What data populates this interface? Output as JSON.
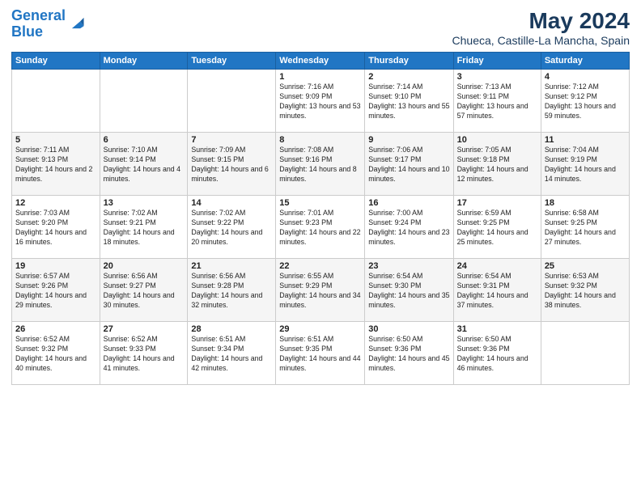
{
  "logo": {
    "line1": "General",
    "line2": "Blue"
  },
  "title": "May 2024",
  "location": "Chueca, Castille-La Mancha, Spain",
  "headers": [
    "Sunday",
    "Monday",
    "Tuesday",
    "Wednesday",
    "Thursday",
    "Friday",
    "Saturday"
  ],
  "weeks": [
    [
      {
        "day": "",
        "info": ""
      },
      {
        "day": "",
        "info": ""
      },
      {
        "day": "",
        "info": ""
      },
      {
        "day": "1",
        "info": "Sunrise: 7:16 AM\nSunset: 9:09 PM\nDaylight: 13 hours and 53 minutes."
      },
      {
        "day": "2",
        "info": "Sunrise: 7:14 AM\nSunset: 9:10 PM\nDaylight: 13 hours and 55 minutes."
      },
      {
        "day": "3",
        "info": "Sunrise: 7:13 AM\nSunset: 9:11 PM\nDaylight: 13 hours and 57 minutes."
      },
      {
        "day": "4",
        "info": "Sunrise: 7:12 AM\nSunset: 9:12 PM\nDaylight: 13 hours and 59 minutes."
      }
    ],
    [
      {
        "day": "5",
        "info": "Sunrise: 7:11 AM\nSunset: 9:13 PM\nDaylight: 14 hours and 2 minutes."
      },
      {
        "day": "6",
        "info": "Sunrise: 7:10 AM\nSunset: 9:14 PM\nDaylight: 14 hours and 4 minutes."
      },
      {
        "day": "7",
        "info": "Sunrise: 7:09 AM\nSunset: 9:15 PM\nDaylight: 14 hours and 6 minutes."
      },
      {
        "day": "8",
        "info": "Sunrise: 7:08 AM\nSunset: 9:16 PM\nDaylight: 14 hours and 8 minutes."
      },
      {
        "day": "9",
        "info": "Sunrise: 7:06 AM\nSunset: 9:17 PM\nDaylight: 14 hours and 10 minutes."
      },
      {
        "day": "10",
        "info": "Sunrise: 7:05 AM\nSunset: 9:18 PM\nDaylight: 14 hours and 12 minutes."
      },
      {
        "day": "11",
        "info": "Sunrise: 7:04 AM\nSunset: 9:19 PM\nDaylight: 14 hours and 14 minutes."
      }
    ],
    [
      {
        "day": "12",
        "info": "Sunrise: 7:03 AM\nSunset: 9:20 PM\nDaylight: 14 hours and 16 minutes."
      },
      {
        "day": "13",
        "info": "Sunrise: 7:02 AM\nSunset: 9:21 PM\nDaylight: 14 hours and 18 minutes."
      },
      {
        "day": "14",
        "info": "Sunrise: 7:02 AM\nSunset: 9:22 PM\nDaylight: 14 hours and 20 minutes."
      },
      {
        "day": "15",
        "info": "Sunrise: 7:01 AM\nSunset: 9:23 PM\nDaylight: 14 hours and 22 minutes."
      },
      {
        "day": "16",
        "info": "Sunrise: 7:00 AM\nSunset: 9:24 PM\nDaylight: 14 hours and 23 minutes."
      },
      {
        "day": "17",
        "info": "Sunrise: 6:59 AM\nSunset: 9:25 PM\nDaylight: 14 hours and 25 minutes."
      },
      {
        "day": "18",
        "info": "Sunrise: 6:58 AM\nSunset: 9:25 PM\nDaylight: 14 hours and 27 minutes."
      }
    ],
    [
      {
        "day": "19",
        "info": "Sunrise: 6:57 AM\nSunset: 9:26 PM\nDaylight: 14 hours and 29 minutes."
      },
      {
        "day": "20",
        "info": "Sunrise: 6:56 AM\nSunset: 9:27 PM\nDaylight: 14 hours and 30 minutes."
      },
      {
        "day": "21",
        "info": "Sunrise: 6:56 AM\nSunset: 9:28 PM\nDaylight: 14 hours and 32 minutes."
      },
      {
        "day": "22",
        "info": "Sunrise: 6:55 AM\nSunset: 9:29 PM\nDaylight: 14 hours and 34 minutes."
      },
      {
        "day": "23",
        "info": "Sunrise: 6:54 AM\nSunset: 9:30 PM\nDaylight: 14 hours and 35 minutes."
      },
      {
        "day": "24",
        "info": "Sunrise: 6:54 AM\nSunset: 9:31 PM\nDaylight: 14 hours and 37 minutes."
      },
      {
        "day": "25",
        "info": "Sunrise: 6:53 AM\nSunset: 9:32 PM\nDaylight: 14 hours and 38 minutes."
      }
    ],
    [
      {
        "day": "26",
        "info": "Sunrise: 6:52 AM\nSunset: 9:32 PM\nDaylight: 14 hours and 40 minutes."
      },
      {
        "day": "27",
        "info": "Sunrise: 6:52 AM\nSunset: 9:33 PM\nDaylight: 14 hours and 41 minutes."
      },
      {
        "day": "28",
        "info": "Sunrise: 6:51 AM\nSunset: 9:34 PM\nDaylight: 14 hours and 42 minutes."
      },
      {
        "day": "29",
        "info": "Sunrise: 6:51 AM\nSunset: 9:35 PM\nDaylight: 14 hours and 44 minutes."
      },
      {
        "day": "30",
        "info": "Sunrise: 6:50 AM\nSunset: 9:36 PM\nDaylight: 14 hours and 45 minutes."
      },
      {
        "day": "31",
        "info": "Sunrise: 6:50 AM\nSunset: 9:36 PM\nDaylight: 14 hours and 46 minutes."
      },
      {
        "day": "",
        "info": ""
      }
    ]
  ]
}
